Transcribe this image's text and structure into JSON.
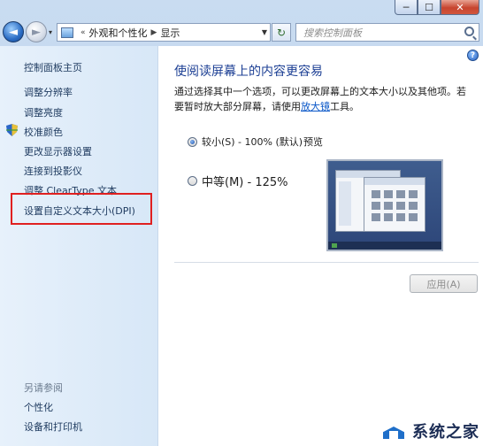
{
  "window": {
    "caption_buttons": {
      "minimize": "─",
      "maximize": "☐",
      "close": "✕"
    }
  },
  "nav": {
    "back_icon": "◄",
    "forward_icon": "►",
    "dropdown": "▾",
    "breadcrumb_sep": "«",
    "crumb1": "外观和个性化",
    "crumb_arrow": "▶",
    "crumb2": "显示",
    "address_arrow": "▼",
    "refresh": "↻",
    "search_placeholder": "搜索控制面板"
  },
  "sidebar": {
    "home": "控制面板主页",
    "links": [
      "调整分辨率",
      "调整亮度",
      "校准颜色",
      "更改显示器设置",
      "连接到投影仪",
      "调整 ClearType 文本",
      "设置自定义文本大小(DPI)"
    ],
    "see_also": "另请参阅",
    "see_also_links": [
      "个性化",
      "设备和打印机"
    ]
  },
  "main": {
    "help": "?",
    "title": "使阅读屏幕上的内容更容易",
    "desc_part1": "通过选择其中一个选项，可以更改屏幕上的文本大小以及其他项。若要暂时放大部分屏幕，请使用",
    "desc_link": "放大镜",
    "desc_part2": "工具。",
    "option_small": "较小(S) - 100% (默认)",
    "option_medium": "中等(M) - 125%",
    "selected": "small",
    "preview_label": "预览",
    "apply_button": "应用(A)"
  },
  "watermark": {
    "text": "系统之家"
  }
}
